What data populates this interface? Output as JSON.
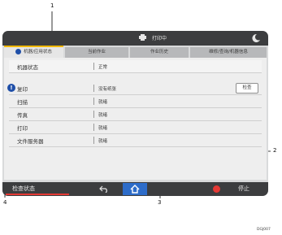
{
  "topbar": {
    "status_text": "打印中"
  },
  "tabs": [
    {
      "label": "机器/应用状态"
    },
    {
      "label": "当前作业"
    },
    {
      "label": "作业历史"
    },
    {
      "label": "维修/查询/机器信息"
    }
  ],
  "machine_status": {
    "label": "机器状态",
    "value": "正常"
  },
  "functions": [
    {
      "label": "复印",
      "value": "没有纸张"
    },
    {
      "label": "扫描",
      "value": "就绪"
    },
    {
      "label": "传真",
      "value": "就绪"
    },
    {
      "label": "打印",
      "value": "就绪"
    },
    {
      "label": "文件服务器",
      "value": "就绪"
    }
  ],
  "check_button": "检查",
  "bottombar": {
    "left_label": "检查状态",
    "right_label": "停止"
  },
  "callouts": {
    "c1": "1",
    "c2": "2",
    "c3": "3",
    "c4": "4"
  },
  "figure_code": "DGJ007",
  "colors": {
    "accent_tab": "#f1b800",
    "bar": "#3c3d3f",
    "home": "#2d6cc9",
    "stop": "#e53935",
    "info": "#1f4fa8"
  },
  "icons": [
    "printer-icon",
    "moon-icon",
    "back-icon",
    "home-icon",
    "stop-icon",
    "info-icon"
  ]
}
